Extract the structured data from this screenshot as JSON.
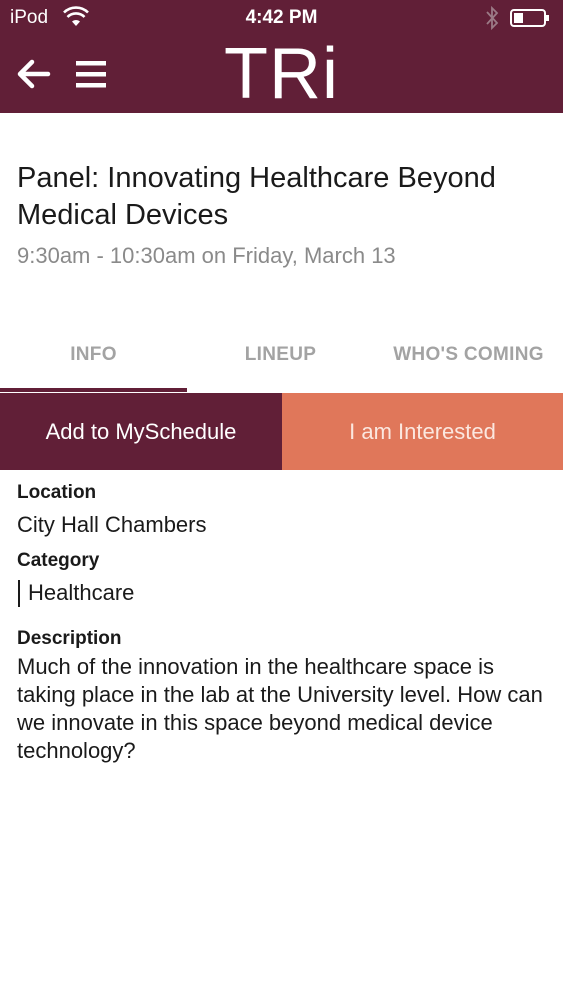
{
  "status_bar": {
    "carrier": "iPod",
    "time": "4:42 PM"
  },
  "header": {
    "brand": "TRi",
    "background_color": "#611f37"
  },
  "icons": {
    "back": "arrow-left-icon",
    "menu": "hamburger-menu-icon",
    "wifi": "wifi-icon",
    "bluetooth": "bluetooth-icon",
    "battery": "battery-icon"
  },
  "event": {
    "title": "Panel: Innovating Healthcare Beyond Medical Devices",
    "time": "9:30am - 10:30am on Friday, March 13"
  },
  "tabs": [
    {
      "label": "INFO",
      "selected": true
    },
    {
      "label": "LINEUP",
      "selected": false
    },
    {
      "label": "WHO'S COMING",
      "selected": false
    }
  ],
  "actions": {
    "schedule_label": "Add to MySchedule",
    "interested_label": "I am Interested",
    "schedule_color": "#611f37",
    "interested_color": "#e0775a"
  },
  "details": {
    "location_label": "Location",
    "location_value": "City Hall Chambers",
    "category_label": "Category",
    "category_value": "Healthcare",
    "description_label": "Description",
    "description_value": "Much of the innovation in the healthcare space is taking place in the lab at the University level. How can we innovate in this space beyond medical device technology?"
  }
}
